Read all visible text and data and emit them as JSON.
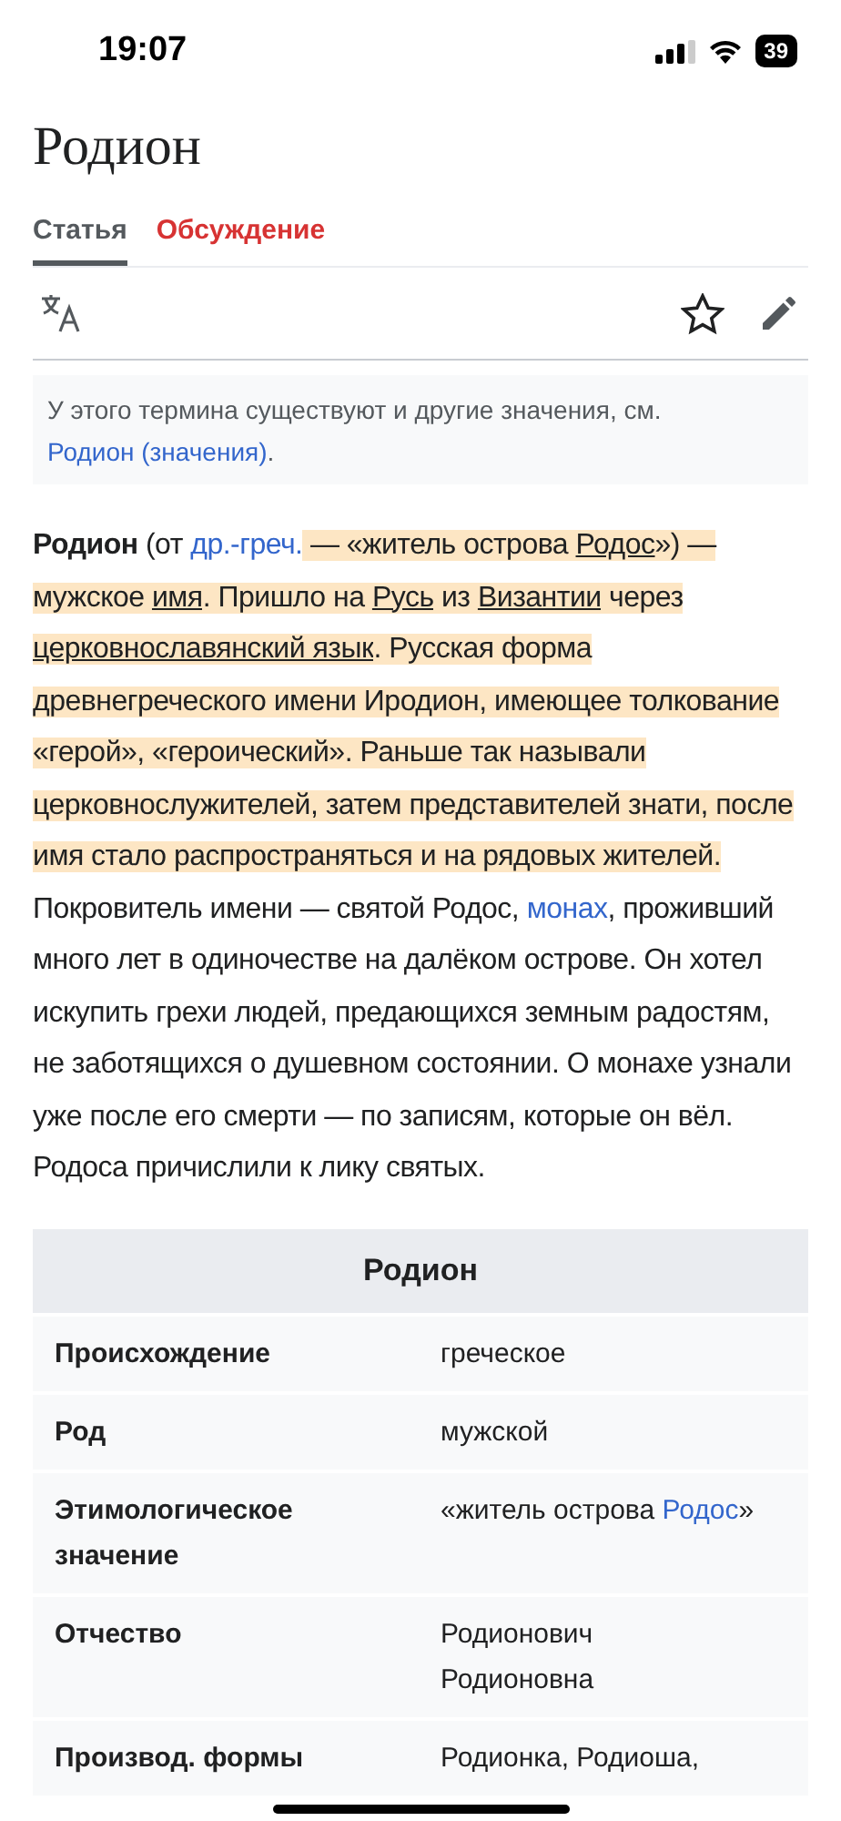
{
  "status_bar": {
    "time": "19:07",
    "battery": "39"
  },
  "title": "Родион",
  "tabs": [
    {
      "label": "Статья",
      "selected": true
    },
    {
      "label": "Обсуждение",
      "selected": false
    }
  ],
  "hatnote": {
    "text": "У этого термина существуют и другие значения, см. ",
    "link": "Родион (значения)",
    "end": "."
  },
  "paragraphs": [
    [
      {
        "text": "Родион",
        "kind": "bold",
        "highlighted": false
      },
      {
        "text": " (от ",
        "kind": "plain",
        "highlighted": false
      },
      {
        "text": "др.-греч.",
        "kind": "link",
        "highlighted": false
      },
      {
        "text": " — «житель острова ",
        "kind": "plain",
        "highlighted": true
      },
      {
        "text": "Родос",
        "kind": "underlined",
        "highlighted": true
      },
      {
        "text": "») — мужское ",
        "kind": "plain",
        "highlighted": true
      },
      {
        "text": "имя",
        "kind": "underlined",
        "highlighted": true
      },
      {
        "text": ". Пришло на ",
        "kind": "plain",
        "highlighted": true
      },
      {
        "text": "Русь",
        "kind": "underlined",
        "highlighted": true
      },
      {
        "text": " из ",
        "kind": "plain",
        "highlighted": true
      },
      {
        "text": "Византии",
        "kind": "underlined",
        "highlighted": true
      },
      {
        "text": " через ",
        "kind": "plain",
        "highlighted": true
      },
      {
        "text": "церковнославянский язык",
        "kind": "underlined",
        "highlighted": true
      },
      {
        "text": ". Русская форма древнегреческого имени Иродион, имеющее толкование «герой», «героический». Раньше так называли церковнослужителей, затем представителей знати, после имя стало распространяться и на рядовых жителей.",
        "kind": "plain",
        "highlighted": true
      }
    ],
    [
      {
        "text": "Покровитель имени — святой Родос, ",
        "kind": "plain",
        "highlighted": false
      },
      {
        "text": "монах",
        "kind": "link",
        "highlighted": false
      },
      {
        "text": ", проживший много лет в одиночестве на далёком острове. Он хотел искупить грехи людей, предающихся земным радостям, не заботящихся о душевном состоянии. О монахе узнали уже после его смерти — по записям, которые он вёл. Родоса причислили к лику святых.",
        "kind": "plain",
        "highlighted": false
      }
    ]
  ],
  "infobox": {
    "title": "Родион",
    "rows": [
      {
        "label": "Происхождение",
        "value": [
          {
            "text": "греческое",
            "kind": "plain"
          }
        ]
      },
      {
        "label": "Род",
        "value": [
          {
            "text": "мужской",
            "kind": "plain"
          }
        ]
      },
      {
        "label": "Этимологическое значение",
        "value": [
          {
            "text": "«житель острова ",
            "kind": "plain"
          },
          {
            "text": "Родос",
            "kind": "link"
          },
          {
            "text": "»",
            "kind": "plain"
          }
        ]
      },
      {
        "label": "Отчество",
        "value": [
          {
            "text": "Родионович",
            "kind": "line"
          },
          {
            "text": "Родионовна",
            "kind": "line"
          }
        ]
      },
      {
        "label": "Производ. формы",
        "value": [
          {
            "text": "Родионка, Родиоша,",
            "kind": "plain"
          }
        ]
      }
    ]
  }
}
